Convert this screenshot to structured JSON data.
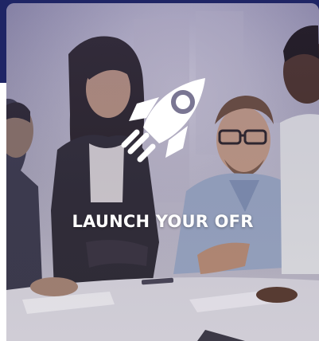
{
  "card": {
    "title": "LAUNCH YOUR OFR",
    "icon": "rocket-icon"
  },
  "colors": {
    "header_band": "#1f2565",
    "title_text": "#ffffff",
    "icon": "#ffffff"
  }
}
